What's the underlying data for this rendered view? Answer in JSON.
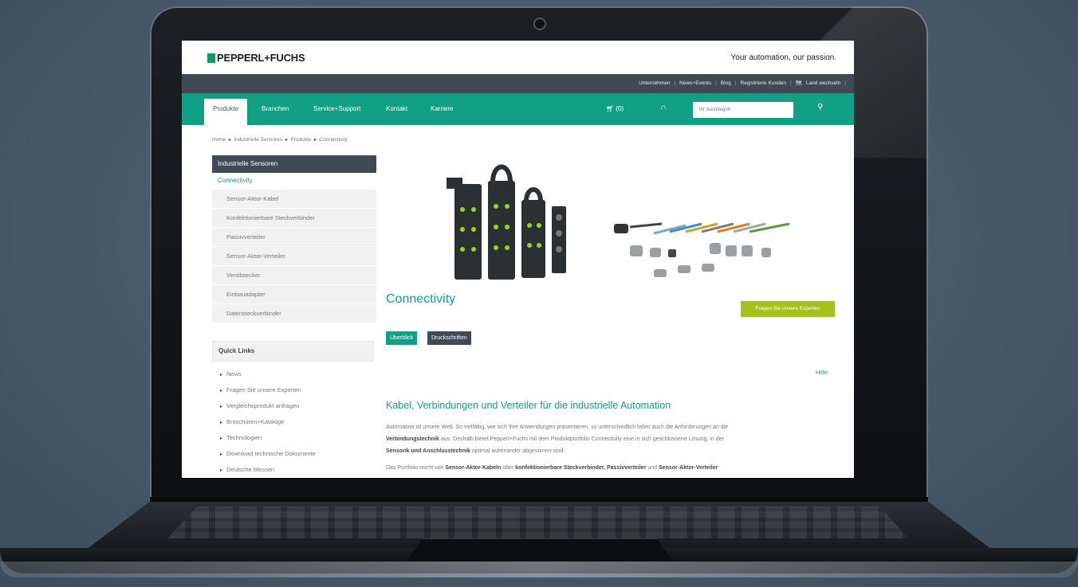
{
  "site": {
    "logo_text": "PEPPERL+FUCHS",
    "tagline": "Your automation, our passion."
  },
  "topbar": {
    "links": [
      "Unternehmen",
      "News+Events",
      "Blog",
      "Registrierte Kunden",
      "Land wechseln"
    ]
  },
  "nav": {
    "items": [
      "Produkte",
      "Branchen",
      "Service+Support",
      "Kontakt",
      "Karriere"
    ],
    "cart_label": "(0)",
    "search_placeholder": "Ihr Suchbegriff"
  },
  "breadcrumb": [
    "Home",
    "Industrielle Sensoren",
    "Produkte",
    "Connectivity"
  ],
  "sidebar": {
    "header": "Industrielle Sensoren",
    "current": "Connectivity",
    "items": [
      "Sensor-Aktor-Kabel",
      "Konfektionierbare Steckverbinder",
      "Passivverteiler",
      "Sensor-Aktor-Verteiler",
      "Ventilstecker",
      "Einbauadapter",
      "Datensteckverbinder"
    ]
  },
  "quick_links": {
    "header": "Quick Links",
    "items": [
      "News",
      "Fragen Sie unsere Experten",
      "Vergleichsprodukt anfragen",
      "Broschüren+Kataloge",
      "Technologien",
      "Download technische Dokumente",
      "Deutsche Messen"
    ]
  },
  "main": {
    "title": "Connectivity",
    "expert_button": "Fragen Sie unsere Experten",
    "tabs": [
      "Überblick",
      "Druckschriften"
    ],
    "help": "Hilfe",
    "heading": "Kabel, Verbindungen und Verteiler für die industrielle Automation",
    "p1_a": "Automation ist unsere Welt. So vielfältig, wie sich Ihre Anwendungen präsentieren, so unterschiedlich fallen auch die Anforderungen an die",
    "p1_b1": "Verbindungstechnik",
    "p1_b2": " aus. Deshalb bietet Pepperl+Fuchs mit dem Produktportfolio Connectivity eine in sich geschlossene Lösung, in der",
    "p1_c1": "Sensorik und Anschlusstechnik",
    "p1_c2": " optimal aufeinander abgestimmt sind.",
    "p2_a": "Das Portfolio reicht von ",
    "p2_b": "Sensor-Aktor-Kabeln",
    "p2_c": " über ",
    "p2_d": "konfektionierbare Steckverbinder, Passivverteiler",
    "p2_e": " und ",
    "p2_f": "Sensor-Aktor-Verteiler"
  },
  "colors": {
    "brand_green": "#11a085",
    "dark_slate": "#3f4a55",
    "lime": "#a3c21c",
    "background": "#4b5b6a"
  }
}
